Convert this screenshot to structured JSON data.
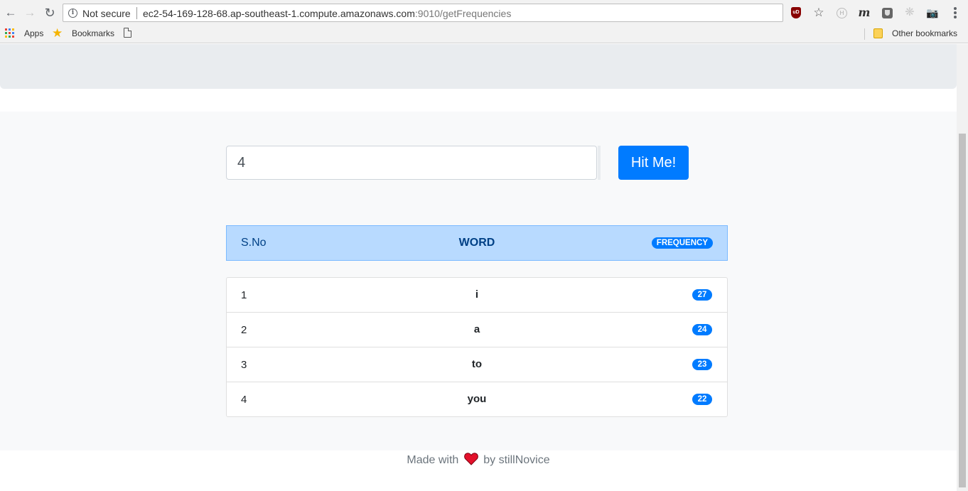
{
  "browser": {
    "security_label": "Not secure",
    "url_host": "ec2-54-169-128-68.ap-southeast-1.compute.amazonaws.com",
    "url_path": ":9010/getFrequencies",
    "extension_ublock_text": "uD",
    "extension_h_text": "H",
    "extension_m_text": "m"
  },
  "bookmarks": {
    "apps_label": "Apps",
    "bookmarks_label": "Bookmarks",
    "other_label": "Other bookmarks"
  },
  "form": {
    "input_value": "4",
    "submit_label": "Hit Me!"
  },
  "table": {
    "headers": {
      "sno": "S.No",
      "word": "WORD",
      "frequency": "FREQUENCY"
    },
    "rows": [
      {
        "sno": "1",
        "word": "i",
        "frequency": "27"
      },
      {
        "sno": "2",
        "word": "a",
        "frequency": "24"
      },
      {
        "sno": "3",
        "word": "to",
        "frequency": "23"
      },
      {
        "sno": "4",
        "word": "you",
        "frequency": "22"
      }
    ]
  },
  "footer": {
    "prefix": "Made with",
    "suffix": "by stillNovice"
  },
  "colors": {
    "primary": "#007bff",
    "table_header_bg": "#b8daff",
    "table_header_text": "#004085",
    "heart": "#e3112b"
  }
}
